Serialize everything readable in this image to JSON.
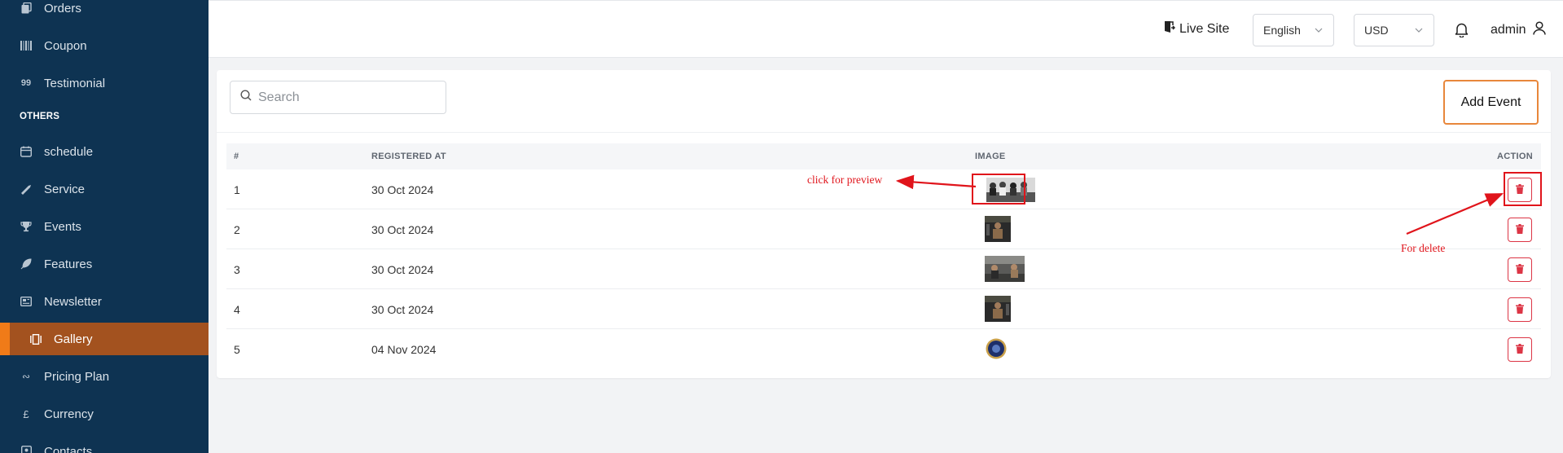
{
  "sidebar": {
    "items": [
      {
        "label": "Orders",
        "icon": "copy-icon"
      },
      {
        "label": "Coupon",
        "icon": "barcode-icon"
      },
      {
        "label": "Testimonial",
        "icon": "quote-icon"
      },
      {
        "label": "schedule",
        "icon": "calendar-icon"
      },
      {
        "label": "Service",
        "icon": "tools-icon"
      },
      {
        "label": "Events",
        "icon": "trophy-icon"
      },
      {
        "label": "Features",
        "icon": "feather-icon"
      },
      {
        "label": "Newsletter",
        "icon": "newspaper-icon"
      },
      {
        "label": "Gallery",
        "icon": "gallery-icon",
        "active": true
      },
      {
        "label": "Pricing Plan",
        "icon": "pricing-icon"
      },
      {
        "label": "Currency",
        "icon": "pound-icon"
      },
      {
        "label": "Contacts",
        "icon": "contacts-icon"
      }
    ],
    "section_heading": "OTHERS"
  },
  "topbar": {
    "live_site": "Live Site",
    "language": "English",
    "currency": "USD",
    "user": "admin"
  },
  "toolbar": {
    "search_placeholder": "Search",
    "add_label": "Add Event"
  },
  "table": {
    "headers": [
      "#",
      "REGISTERED AT",
      "IMAGE",
      "ACTION"
    ],
    "rows": [
      {
        "num": "1",
        "date": "30 Oct 2024",
        "image": "group-photo"
      },
      {
        "num": "2",
        "date": "30 Oct 2024",
        "image": "gym-photo"
      },
      {
        "num": "3",
        "date": "30 Oct 2024",
        "image": "gym-wide-photo"
      },
      {
        "num": "4",
        "date": "30 Oct 2024",
        "image": "gym-photo"
      },
      {
        "num": "5",
        "date": "04 Nov 2024",
        "image": "badge-logo"
      }
    ]
  },
  "annotations": {
    "preview": "click for preview",
    "delete": "For delete"
  },
  "colors": {
    "sidebar_bg": "#0e3352",
    "active_bg": "#a3521f",
    "accent": "#f07b18",
    "danger": "#dc3545",
    "annotation": "#e0141b"
  }
}
